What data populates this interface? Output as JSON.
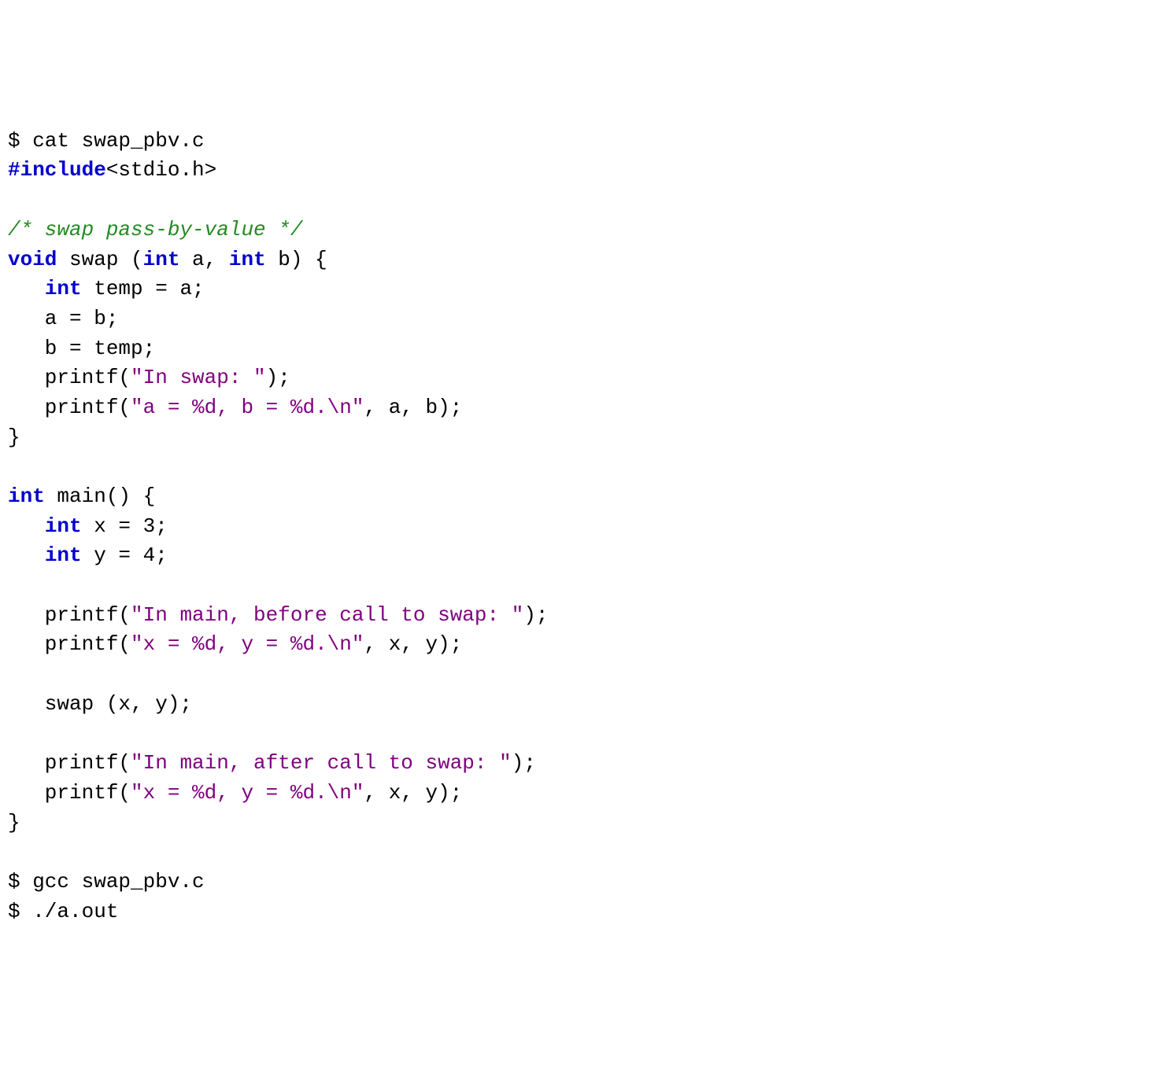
{
  "code": {
    "l01_a": "$ cat swap_pbv.c",
    "l02_kw": "#include",
    "l02_b": "<stdio.h>",
    "l03": "",
    "l04_cm": "/* swap pass-by-value */",
    "l05_kw1": "void",
    "l05_a": " swap (",
    "l05_kw2": "int",
    "l05_b": " a, ",
    "l05_kw3": "int",
    "l05_c": " b) {",
    "l06_pad": "   ",
    "l06_kw": "int",
    "l06_a": " temp = a;",
    "l07": "   a = b;",
    "l08": "   b = temp;",
    "l09_a": "   printf(",
    "l09_st": "\"In swap: \"",
    "l09_b": ");",
    "l10_a": "   printf(",
    "l10_st": "\"a = %d, b = %d.\\n\"",
    "l10_b": ", a, b);",
    "l11": "}",
    "l12": "",
    "l13_kw": "int",
    "l13_a": " main() {",
    "l14_pad": "   ",
    "l14_kw": "int",
    "l14_a": " x = 3;",
    "l15_pad": "   ",
    "l15_kw": "int",
    "l15_a": " y = 4;",
    "l16": "",
    "l17_a": "   printf(",
    "l17_st": "\"In main, before call to swap: \"",
    "l17_b": ");",
    "l18_a": "   printf(",
    "l18_st": "\"x = %d, y = %d.\\n\"",
    "l18_b": ", x, y);",
    "l19": "",
    "l20": "   swap (x, y);",
    "l21": "",
    "l22_a": "   printf(",
    "l22_st": "\"In main, after call to swap: \"",
    "l22_b": ");",
    "l23_a": "   printf(",
    "l23_st": "\"x = %d, y = %d.\\n\"",
    "l23_b": ", x, y);",
    "l24": "}",
    "l25": "",
    "l26": "$ gcc swap_pbv.c",
    "l27": "$ ./a.out"
  }
}
